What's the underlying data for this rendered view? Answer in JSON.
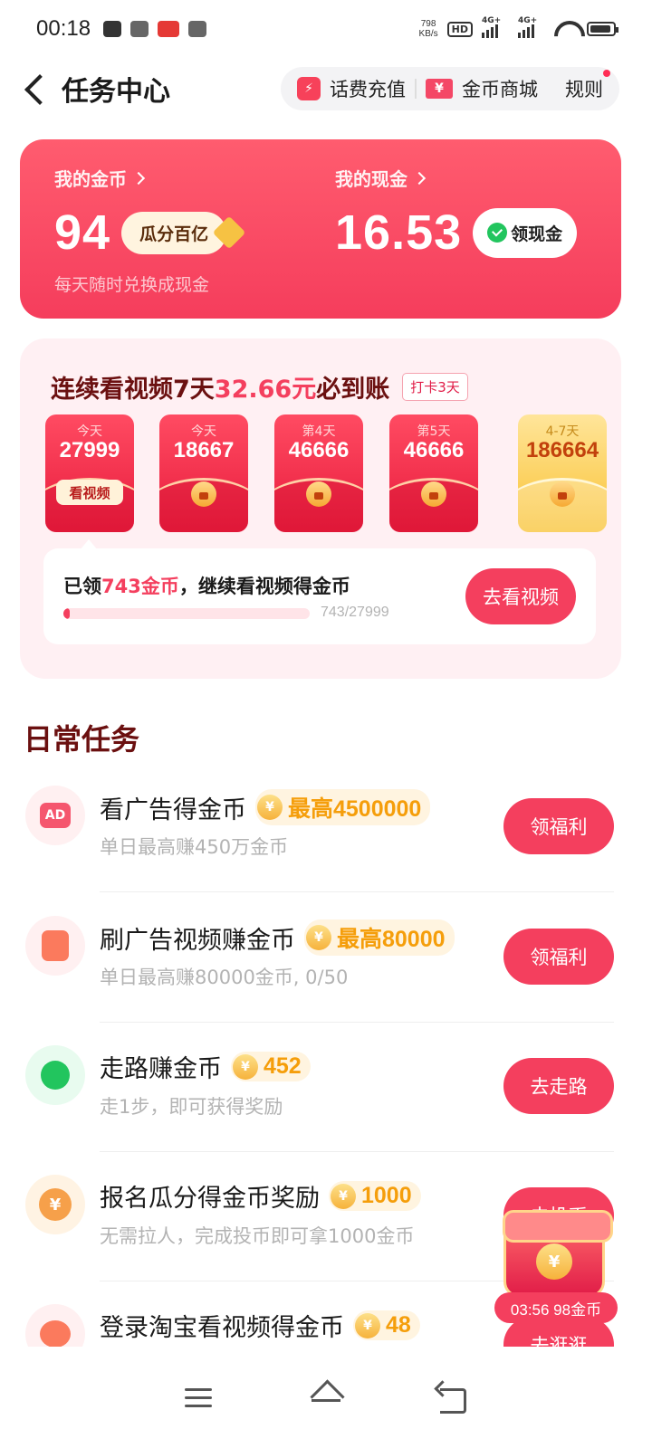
{
  "status_bar": {
    "time": "00:18",
    "net_speed_value": "798",
    "net_speed_unit": "KB/s",
    "hd": "HD",
    "signal1": "4G+",
    "signal2": "4G+"
  },
  "header": {
    "title": "任务中心",
    "recharge_label": "话费充值",
    "mall_label": "金币商城",
    "rules_label": "规则"
  },
  "wallet": {
    "coins_label": "我的金币",
    "coins_value": "94",
    "coins_action": "瓜分百亿",
    "cash_label": "我的现金",
    "cash_value": "16.53",
    "cash_action": "领现金",
    "subtitle": "每天随时兑换成现金"
  },
  "checkin": {
    "title_part1": "连续看视频7天",
    "title_amount": "32.66元",
    "title_part2": "必到账",
    "badge": "打卡3天",
    "days": [
      {
        "label": "今天",
        "value": "27999",
        "action": "看视频"
      },
      {
        "label": "今天",
        "value": "18667"
      },
      {
        "label": "第4天",
        "value": "46666"
      },
      {
        "label": "第5天",
        "value": "46666"
      },
      {
        "label": "4-7天",
        "value": "186664"
      }
    ],
    "progress_prefix": "已领",
    "progress_amount": "743金币",
    "progress_suffix": "，继续看视频得金币",
    "progress_count": "743/27999",
    "progress_fraction": 0.0265,
    "progress_button": "去看视频"
  },
  "daily": {
    "section_title": "日常任务",
    "tasks": [
      {
        "icon": "ad-icon",
        "icon_text": "AD",
        "title": "看广告得金币",
        "reward": "最高4500000",
        "subtitle": "单日最高赚450万金币",
        "button": "领福利"
      },
      {
        "icon": "video-icon",
        "title": "刷广告视频赚金币",
        "reward": "最高80000",
        "subtitle": "单日最高赚80000金币, 0/50",
        "button": "领福利"
      },
      {
        "icon": "walk-icon",
        "title": "走路赚金币",
        "reward": "452",
        "subtitle": "走1步，即可获得奖励",
        "button": "去走路"
      },
      {
        "icon": "yuan-icon",
        "icon_text": "¥",
        "title": "报名瓜分得金币奖励",
        "reward": "1000",
        "subtitle": "无需拉人，完成投币即可拿1000金币",
        "button": "去投币"
      },
      {
        "icon": "taobao-icon",
        "title": "登录淘宝看视频得金币",
        "reward": "48",
        "subtitle": "",
        "button": "去逛逛"
      }
    ],
    "coin_glyph": "¥"
  },
  "floating": {
    "coin_glyph": "¥",
    "label": "03:56 98金币"
  },
  "colors": {
    "primary": "#f43f5e",
    "wallet_bg": "#f7475f",
    "gold": "#f59e0b",
    "checkin_bg": "#fff0f3"
  }
}
